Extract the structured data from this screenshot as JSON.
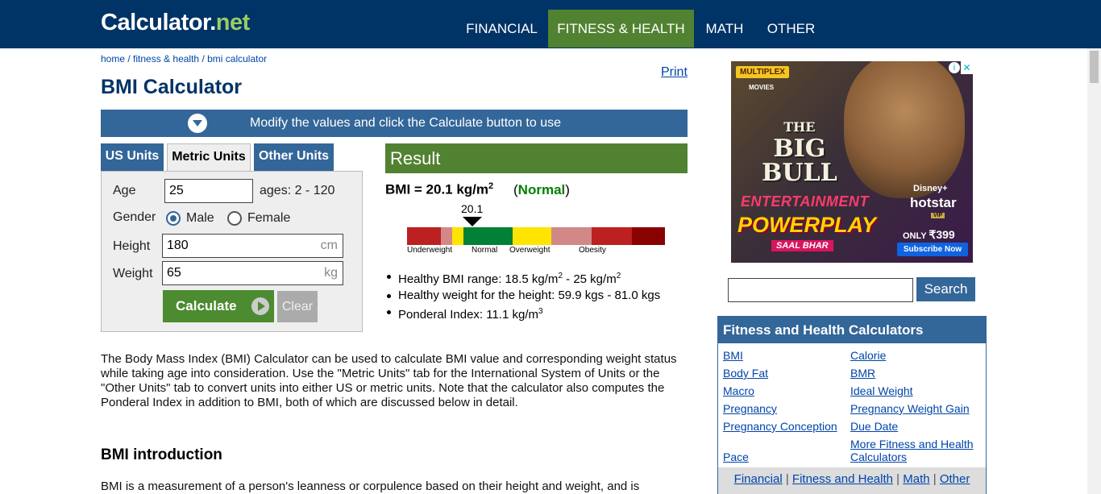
{
  "header": {
    "logo_main": "Calculator",
    "logo_dot": ".",
    "logo_net": "net",
    "nav": [
      "FINANCIAL",
      "FITNESS & HEALTH",
      "MATH",
      "OTHER"
    ]
  },
  "breadcrumb": {
    "home": "home",
    "sep1": " / ",
    "fitness": "fitness & health",
    "sep2": " / ",
    "current": "bmi calculator"
  },
  "print_label": "Print",
  "page_title": "BMI Calculator",
  "modify_bar": "Modify the values and click the Calculate button to use",
  "tabs": [
    "US Units",
    "Metric Units",
    "Other Units"
  ],
  "form": {
    "age_label": "Age",
    "age_value": "25",
    "age_hint": "ages: 2 - 120",
    "gender_label": "Gender",
    "male_label": "Male",
    "female_label": "Female",
    "height_label": "Height",
    "height_value": "180",
    "height_unit": "cm",
    "weight_label": "Weight",
    "weight_value": "65",
    "weight_unit": "kg",
    "calculate_label": "Calculate",
    "clear_label": "Clear"
  },
  "result": {
    "header": "Result",
    "bmi_text": "BMI = 20.1 kg/m",
    "bmi_sup": "2",
    "class_open": "(",
    "class_label": "Normal",
    "class_close": ")",
    "gauge_value": "20.1",
    "gauge_labels": [
      "Underweight",
      "Normal",
      "Overweight",
      "Obesity"
    ],
    "gauge_colors": [
      "#bc2020",
      "#d38888",
      "#ffe400",
      "#008137",
      "#ffe400",
      "#d38888",
      "#bc2020",
      "#8a0101"
    ],
    "stat1_a": "Healthy BMI range: 18.5 kg/m",
    "stat1_sup1": "2",
    "stat1_b": " - 25 kg/m",
    "stat1_sup2": "2",
    "stat2": "Healthy weight for the height: 59.9 kgs - 81.0 kgs",
    "stat3_a": "Ponderal Index: 11.1 kg/m",
    "stat3_sup": "3"
  },
  "description": "The Body Mass Index (BMI) Calculator can be used to calculate BMI value and corresponding weight status while taking age into consideration. Use the \"Metric Units\" tab for the International System of Units or the \"Other Units\" tab to convert units into either US or metric units. Note that the calculator also computes the Ponderal Index in addition to BMI, both of which are discussed below in detail.",
  "intro_heading": "BMI introduction",
  "intro_text": "BMI is a measurement of a person's leanness or corpulence based on their height and weight, and is",
  "ad": {
    "badge": "MULTIPLEX",
    "movies": "MOVIES",
    "title_line1": "THE",
    "title_line2": "BIG",
    "title_line3": "BULL",
    "entertainment": "ENTERTAINMENT",
    "powerplay": "POWERPLAY",
    "saal_bhar": "SAAL BHAR",
    "disney": "Disney+",
    "hotstar": "hotstar",
    "vip": "VIP",
    "only": "ONLY",
    "price": "₹399",
    "subscribe": "Subscribe Now",
    "info": "i",
    "close": "✕"
  },
  "search": {
    "value": "",
    "button": "Search"
  },
  "fitness_box": {
    "header": "Fitness and Health Calculators",
    "left_links": [
      "BMI",
      "Body Fat",
      "Macro",
      "Pregnancy",
      "Pregnancy Conception",
      "Pace"
    ],
    "right_links": [
      "Calorie",
      "BMR",
      "Ideal Weight",
      "Pregnancy Weight Gain",
      "Due Date",
      "More Fitness and Health",
      "Calculators"
    ],
    "footer": [
      "Financial",
      "Fitness and Health",
      "Math",
      "Other"
    ],
    "footer_sep": " | "
  }
}
